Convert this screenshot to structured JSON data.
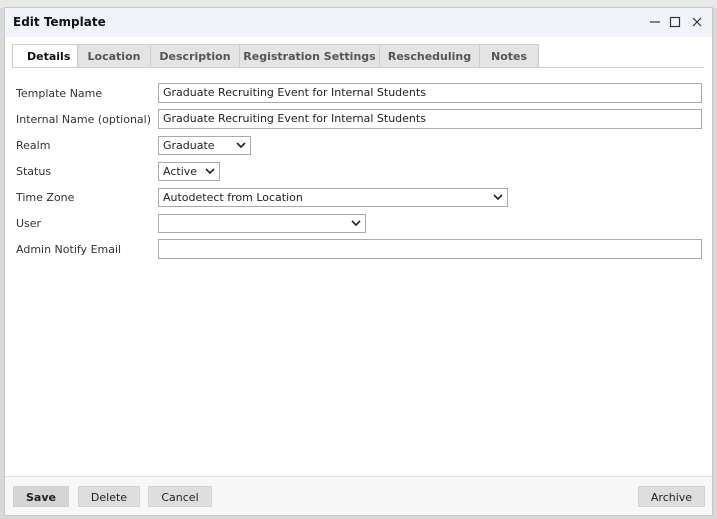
{
  "window": {
    "title": "Edit Template"
  },
  "tabs": [
    {
      "label": "Details",
      "active": true
    },
    {
      "label": "Location",
      "active": false
    },
    {
      "label": "Description",
      "active": false
    },
    {
      "label": "Registration Settings",
      "active": false
    },
    {
      "label": "Rescheduling",
      "active": false
    },
    {
      "label": "Notes",
      "active": false
    }
  ],
  "form": {
    "template_name": {
      "label": "Template Name",
      "value": "Graduate Recruiting Event for Internal Students"
    },
    "internal_name": {
      "label": "Internal Name (optional)",
      "value": "Graduate Recruiting Event for Internal Students"
    },
    "realm": {
      "label": "Realm",
      "value": "Graduate"
    },
    "status": {
      "label": "Status",
      "value": "Active"
    },
    "time_zone": {
      "label": "Time Zone",
      "value": "Autodetect from Location"
    },
    "user": {
      "label": "User",
      "value": ""
    },
    "admin_notify_email": {
      "label": "Admin Notify Email",
      "value": ""
    }
  },
  "footer": {
    "save_label": "Save",
    "delete_label": "Delete",
    "cancel_label": "Cancel",
    "archive_label": "Archive"
  },
  "icons": {
    "minimize": "minimize-icon",
    "maximize": "maximize-icon",
    "close": "close-icon",
    "dropdown": "chevron-down-icon"
  },
  "colors": {
    "titlebar": "#f1f5fb",
    "tab_inactive": "#e4e4e4",
    "button": "#dedede"
  }
}
